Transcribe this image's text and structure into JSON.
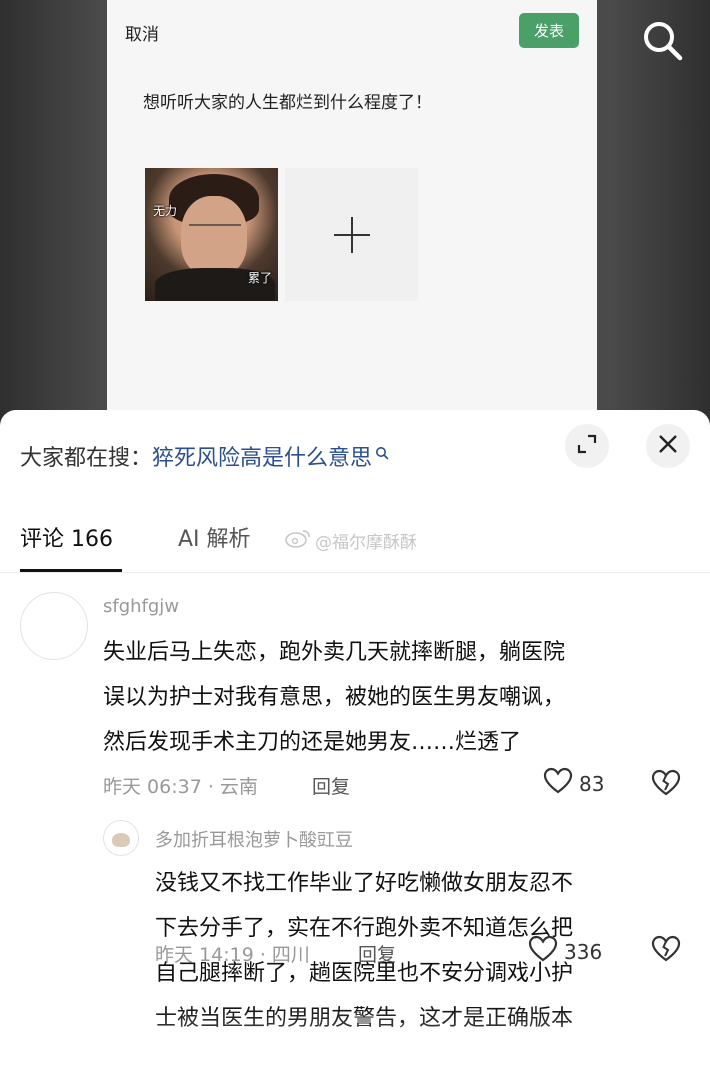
{
  "post_editor": {
    "cancel_label": "取消",
    "publish_label": "发表",
    "post_text": "想听听大家的人生都烂到什么程度了！",
    "image_caption_left": "无力",
    "image_caption_right": "累了"
  },
  "hot_search": {
    "prefix": "大家都在搜：",
    "keyword": "猝死风险高是什么意思"
  },
  "tabs": {
    "comments_label": "评论 166",
    "ai_label": "AI 解析",
    "watermark": "@福尔摩酥酥"
  },
  "comments": [
    {
      "username": "sfghfgjw",
      "lines": [
        "失业后马上失恋，跑外卖几天就摔断腿，躺医院",
        "误以为护士对我有意思，被她的医生男友嘲讽，",
        "然后发现手术主刀的还是她男友……烂透了"
      ],
      "meta": "昨天 06:37 · 云南",
      "reply_label": "回复",
      "likes": "83"
    },
    {
      "username": "多加折耳根泡萝卜酸豇豆",
      "lines": [
        "没钱又不找工作毕业了好吃懒做女朋友忍不",
        "下去分手了，实在不行跑外卖不知道怎么把",
        "自己腿摔断了，趟医院里也不安分调戏小护",
        "士被当医生的男朋友警告，这才是正确版本"
      ],
      "meta": "昨天 14:19 · 四川",
      "reply_label": "回复",
      "likes": "336"
    }
  ],
  "colors": {
    "publish_green": "#4aa068",
    "keyword_blue": "#2b4f8f",
    "meta_gray": "#999999"
  }
}
